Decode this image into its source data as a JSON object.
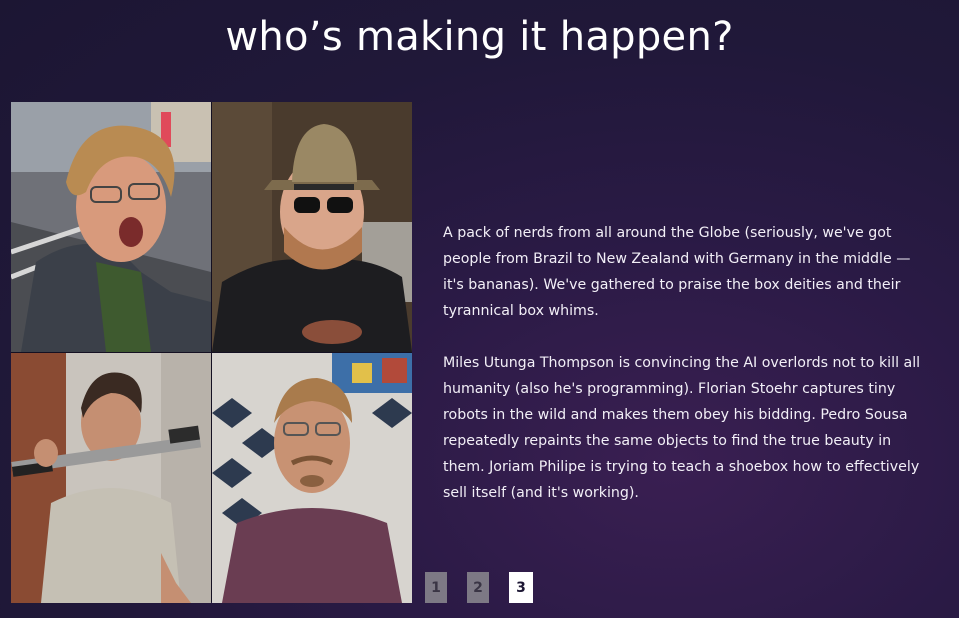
{
  "title": "who’s making it happen?",
  "photos": [
    {
      "alt": "Team member with messy hair making a surprised face on a city street"
    },
    {
      "alt": "Team member wearing a straw fedora and sunglasses"
    },
    {
      "alt": "Team member holding a vacuum pipe over his shoulder"
    },
    {
      "alt": "Team member with glasses and mustache in front of mosaic tiles"
    }
  ],
  "description": {
    "paragraph_1": "A pack of nerds from all around the Globe (seriously, we've got people from Brazil to New Zealand with Germany in the middle — it's bananas). We've gathered to praise the box deities and their tyrannical box whims.",
    "paragraph_2": "Miles Utunga Thompson is convincing the AI overlords not to kill all humanity (also he's programming). Florian Stoehr captures tiny robots in the wild and makes them obey his bidding. Pedro Sousa repeatedly repaints the same objects to find the true beauty in them. Joriam Philipe is trying to teach a shoebox how to effectively sell itself (and it's working)."
  },
  "pagination": {
    "pages": [
      "1",
      "2",
      "3"
    ],
    "active": "3"
  },
  "colors": {
    "background": "#221a3d",
    "active_page": "#ffffff",
    "inactive_page": "#7d7985"
  }
}
